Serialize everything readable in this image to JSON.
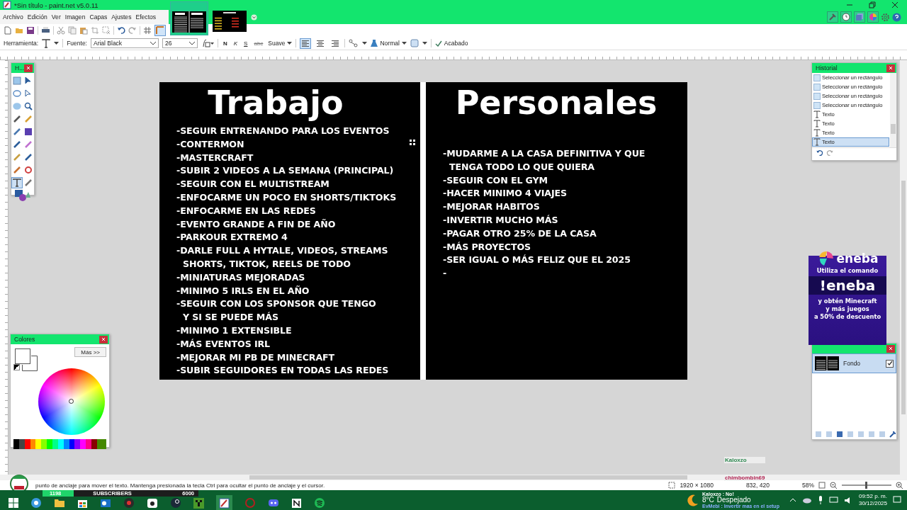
{
  "window": {
    "title": "*Sin título - paint.net v5.0.11"
  },
  "menu": [
    "Archivo",
    "Edición",
    "Ver",
    "Imagen",
    "Capas",
    "Ajustes",
    "Efectos"
  ],
  "documents": [
    {
      "selected": true
    },
    {
      "selected": false
    }
  ],
  "options": {
    "tool_label": "Herramienta:",
    "font_label": "Fuente:",
    "font": "Arial Black",
    "size": "26",
    "bold": "N",
    "italic": "K",
    "underline": "S",
    "strike": "abc",
    "antialias": "Suave",
    "blend": "Normal",
    "finish": "Acabado"
  },
  "alignment": [
    {
      "selected": true
    },
    {
      "selected": false
    },
    {
      "selected": false
    }
  ],
  "canvas": {
    "columns": [
      {
        "heading": "Trabajo",
        "lines": [
          {
            "text": "-SEGUIR ENTRENANDO PARA LOS EVENTOS",
            "kind": "item"
          },
          {
            "text": "-CONTERMON",
            "kind": "item"
          },
          {
            "text": "-MASTERCRAFT",
            "kind": "item"
          },
          {
            "text": "-SUBIR 2 VIDEOS A LA SEMANA (PRINCIPAL)",
            "kind": "item"
          },
          {
            "text": "-SEGUIR CON EL MULTISTREAM",
            "kind": "item"
          },
          {
            "text": "-ENFOCARME UN POCO EN SHORTS/TIKTOKS",
            "kind": "item"
          },
          {
            "text": "-ENFOCARME EN LAS REDES",
            "kind": "item"
          },
          {
            "text": "-EVENTO GRANDE A FIN DE AÑO",
            "kind": "item"
          },
          {
            "text": "-PARKOUR EXTREMO 4",
            "kind": "item"
          },
          {
            "text": "-DARLE FULL A HYTALE, VIDEOS, STREAMS",
            "kind": "item"
          },
          {
            "text": "SHORTS, TIKTOK, REELS DE TODO",
            "kind": "continuation"
          },
          {
            "text": "-MINIATURAS MEJORADAS",
            "kind": "item"
          },
          {
            "text": "-MINIMO 5 IRLS EN EL AÑO",
            "kind": "item"
          },
          {
            "text": "-SEGUIR CON LOS SPONSOR QUE TENGO",
            "kind": "item"
          },
          {
            "text": "Y SI SE PUEDE MÁS",
            "kind": "continuation"
          },
          {
            "text": "-MINIMO 1 EXTENSIBLE",
            "kind": "item"
          },
          {
            "text": "-MÁS EVENTOS IRL",
            "kind": "item"
          },
          {
            "text": "-MEJORAR MI PB DE MINECRAFT",
            "kind": "item"
          },
          {
            "text": "-SUBIR SEGUIDORES EN TODAS LAS REDES",
            "kind": "item"
          }
        ]
      },
      {
        "heading": "Personales",
        "lines": [
          {
            "text": "-MUDARME A LA CASA DEFINITIVA Y QUE",
            "kind": "item"
          },
          {
            "text": "TENGA TODO LO QUE QUIERA",
            "kind": "continuation"
          },
          {
            "text": "-SEGUIR CON EL GYM",
            "kind": "item"
          },
          {
            "text": "-HACER MINIMO 4 VIAJES",
            "kind": "item"
          },
          {
            "text": "-MEJORAR HABITOS",
            "kind": "item"
          },
          {
            "text": "-INVERTIR MUCHO MÁS",
            "kind": "item"
          },
          {
            "text": "-PAGAR OTRO 25% DE LA CASA",
            "kind": "item"
          },
          {
            "text": "-MÁS PROYECTOS",
            "kind": "item"
          },
          {
            "text": "-SER IGUAL O MÁS FELIZ QUE EL 2025",
            "kind": "item"
          },
          {
            "text": "-",
            "kind": "item"
          }
        ]
      }
    ]
  },
  "tools_panel": {
    "title": "H...",
    "tools": [
      {
        "selected": false
      },
      {
        "selected": false
      },
      {
        "selected": false
      },
      {
        "selected": false
      },
      {
        "selected": false
      },
      {
        "selected": false
      },
      {
        "selected": false
      },
      {
        "selected": false
      },
      {
        "selected": false
      },
      {
        "selected": false
      },
      {
        "selected": false
      },
      {
        "selected": false
      },
      {
        "selected": false
      },
      {
        "selected": false
      },
      {
        "selected": false
      },
      {
        "selected": false
      },
      {
        "selected": true
      },
      {
        "selected": false
      }
    ]
  },
  "colors_panel": {
    "title": "Colores",
    "more_button": "Más >>"
  },
  "history_panel": {
    "title": "Historial",
    "items": [
      {
        "label": "Seleccionar un rectángulo",
        "kind": "select",
        "selected": false
      },
      {
        "label": "Seleccionar un rectángulo",
        "kind": "select",
        "selected": false
      },
      {
        "label": "Seleccionar un rectángulo",
        "kind": "select",
        "selected": false
      },
      {
        "label": "Seleccionar un rectángulo",
        "kind": "select",
        "selected": false
      },
      {
        "label": "Texto",
        "kind": "text",
        "selected": false
      },
      {
        "label": "Texto",
        "kind": "text",
        "selected": false
      },
      {
        "label": "Texto",
        "kind": "text",
        "selected": false
      },
      {
        "label": "Texto",
        "kind": "text",
        "selected": true
      }
    ]
  },
  "layers_panel": {
    "layers": [
      {
        "name": "Fondo",
        "visible": true,
        "selected": true
      }
    ]
  },
  "promo": {
    "brand": "eneba",
    "line_1": "Utiliza el comando",
    "command": "!eneba",
    "line_2": "y obtén Minecraft",
    "line_3": "y más juegos",
    "line_4": "a 50% de descuento"
  },
  "chat": [
    {
      "user": "Kaloxzo",
      "color": "#2f8a52"
    },
    {
      "user": "chimbombin69",
      "color": "#b01e4e"
    }
  ],
  "status_bar": {
    "hint": "punto de anclaje para mover el texto. Mantenga presionada la tecla Ctrl para ocultar el punto de anclaje y el cursor.",
    "image_size": "1920 × 1080",
    "cursor": "832, 420",
    "zoom": "58%",
    "zoom_slider": {
      "level": 0.5
    }
  },
  "sub_goal": {
    "count": "1198",
    "label": "SUBSCRIBERS",
    "goal": "6000",
    "level": 0.2
  },
  "taskbar": {
    "weather_temp": "8°C",
    "weather_text": "Despejado",
    "overlay_1": "Kaloxzo : No!",
    "overlay_2": "EvMebi : Invertir mas en el setup",
    "time": "09:52 p. m.",
    "date": "30/12/2025"
  }
}
